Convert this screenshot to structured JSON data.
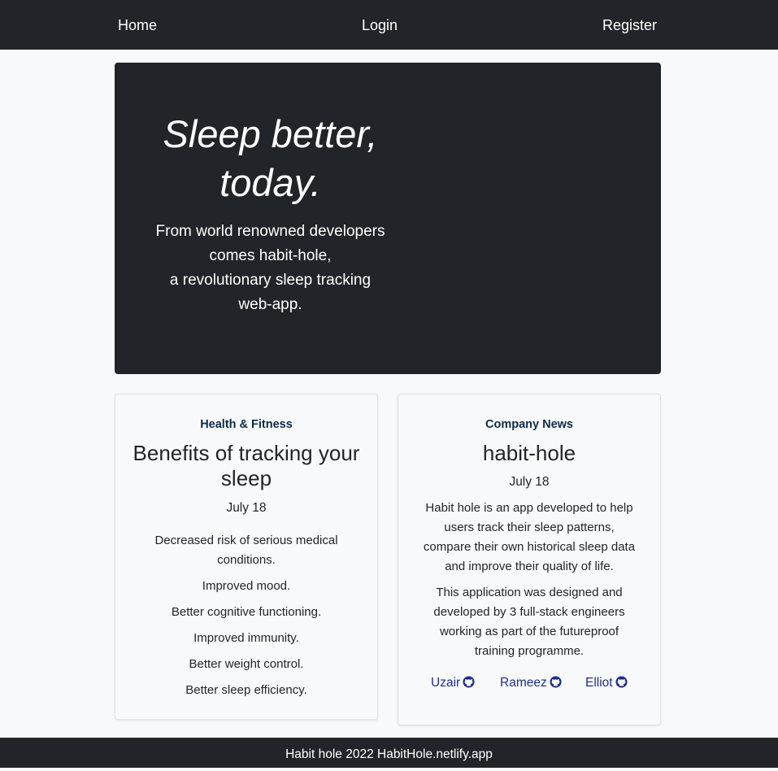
{
  "nav": {
    "home": "Home",
    "login": "Login",
    "register": "Register"
  },
  "hero": {
    "title_line1": "Sleep better,",
    "title_line2": "today.",
    "text_lines": [
      "From world renowned developers",
      "comes habit-hole,",
      "a revolutionary sleep tracking",
      "web-app."
    ]
  },
  "card_health": {
    "category": "Health & Fitness",
    "title": "Benefits of tracking your sleep",
    "date": "July 18",
    "items": [
      "Decreased risk of serious medical conditions.",
      "Improved mood.",
      "Better cognitive functioning.",
      "Improved immunity.",
      "Better weight control.",
      "Better sleep efficiency."
    ]
  },
  "card_news": {
    "category": "Company News",
    "title": "habit-hole",
    "date": "July 18",
    "paragraphs": [
      "Habit hole is an app developed to help users track their sleep patterns, compare their own historical sleep data and improve their quality of life.",
      "This application was designed and developed by 3 full-stack engineers working as part of the futureproof training programme."
    ],
    "authors": [
      {
        "name": "Uzair",
        "icon": "github-icon"
      },
      {
        "name": "Rameez",
        "icon": "github-icon"
      },
      {
        "name": "Elliot",
        "icon": "github-icon"
      }
    ]
  },
  "footer": {
    "text": "Habit hole 2022 HabitHole.netlify.app"
  },
  "colors": {
    "dark": "#212529",
    "background": "#f8f9fa",
    "category": "#0d2a4a",
    "link": "#1c2f8c"
  }
}
